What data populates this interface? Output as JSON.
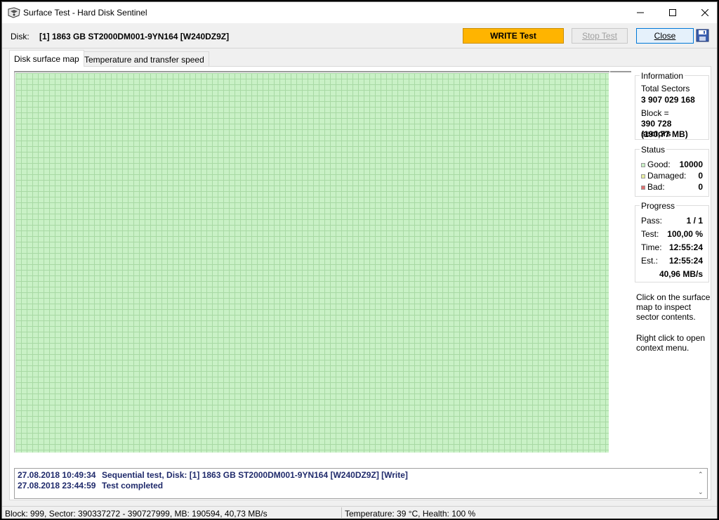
{
  "window": {
    "title": "Surface Test - Hard Disk Sentinel"
  },
  "toolbar": {
    "disk_label": "Disk:",
    "disk_value": "[1] 1863 GB  ST2000DM001-9YN164 [W240DZ9Z]",
    "write_test_label": "WRITE Test",
    "stop_test_label": "Stop Test",
    "close_label": "Close"
  },
  "tabs": [
    {
      "label": "Disk surface map",
      "active": true
    },
    {
      "label": "Temperature and transfer speed",
      "active": false
    }
  ],
  "information": {
    "title": "Information",
    "total_sectors_label": "Total Sectors",
    "total_sectors_value": "3 907 029 168",
    "block_label": "Block =",
    "block_sectors": "390 728 sectors",
    "block_size": "(190,77 MB)"
  },
  "status": {
    "title": "Status",
    "good_label": "Good:",
    "good_value": "10000",
    "damaged_label": "Damaged:",
    "damaged_value": "0",
    "bad_label": "Bad:",
    "bad_value": "0",
    "colors": {
      "good": "#c9f1c6",
      "damaged": "#e8f0a0",
      "bad": "#e07070"
    }
  },
  "progress": {
    "title": "Progress",
    "pass_label": "Pass:",
    "pass_value": "1 / 1",
    "test_label": "Test:",
    "test_value": "100,00 %",
    "time_label": "Time:",
    "time_value": "12:55:24",
    "est_label": "Est.:",
    "est_value": "12:55:24",
    "speed": "40,96 MB/s"
  },
  "hints": {
    "line1": "Click on the surface",
    "line2": "map to inspect",
    "line3": "sector contents.",
    "line4": "Right click to open",
    "line5": "context menu."
  },
  "log": [
    {
      "timestamp": "27.08.2018  10:49:34",
      "message": "Sequential test, Disk: [1] 1863 GB  ST2000DM001-9YN164 [W240DZ9Z] [Write]"
    },
    {
      "timestamp": "27.08.2018  23:44:59",
      "message": "Test completed"
    }
  ],
  "statusbar": {
    "left": "Block: 999, Sector: 390337272 - 390727999, MB: 190594, 40,73 MB/s",
    "right": "Temperature: 39  °C,  Health: 100 %"
  },
  "colors": {
    "write_accent": "#ffb400",
    "surface_good": "#c9f1c6",
    "log_text": "#1f2a6b"
  }
}
